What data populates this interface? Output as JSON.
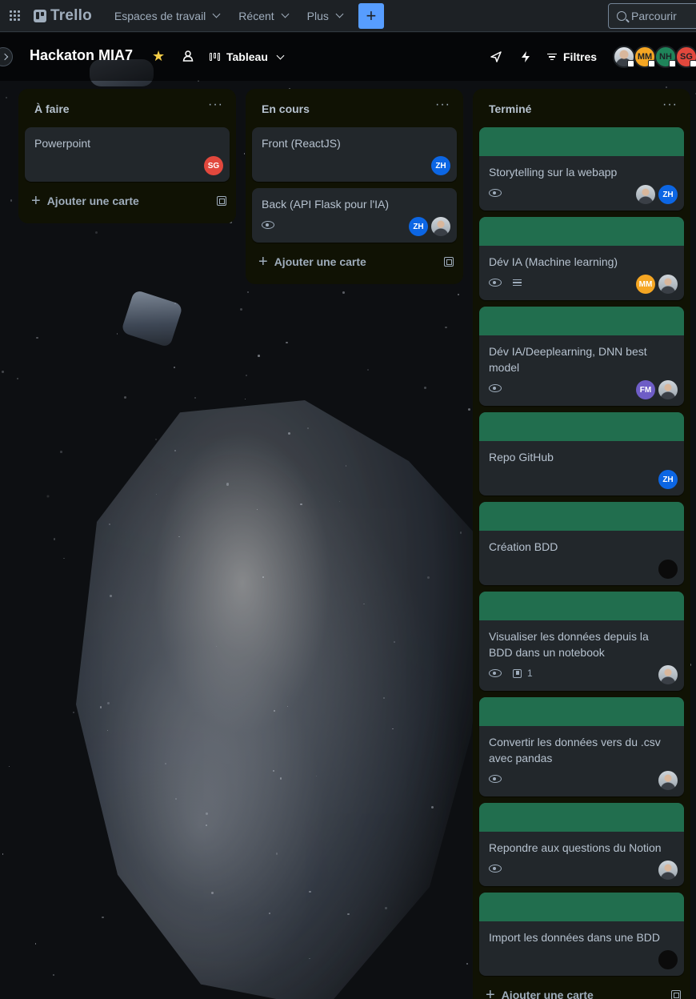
{
  "nav": {
    "logo": "Trello",
    "workspaces": "Espaces de travail",
    "recent": "Récent",
    "more": "Plus",
    "create": "+",
    "search_placeholder": "Parcourir"
  },
  "board": {
    "title": "Hackaton MIA7",
    "view": "Tableau",
    "filters": "Filtres",
    "members": [
      {
        "initials": "",
        "color": "#c9ced4",
        "photo": true
      },
      {
        "initials": "MM",
        "color": "#f5a623"
      },
      {
        "initials": "NH",
        "color": "#1f845a"
      },
      {
        "initials": "SG",
        "color": "#e2483d"
      }
    ]
  },
  "lists": [
    {
      "title": "À faire",
      "add_label": "Ajouter une carte",
      "cards": [
        {
          "title": "Powerpoint",
          "cover": false,
          "watch": false,
          "avatars": [
            {
              "initials": "SG",
              "color": "#e2483d"
            }
          ]
        }
      ]
    },
    {
      "title": "En cours",
      "add_label": "Ajouter une carte",
      "cards": [
        {
          "title": "Front (ReactJS)",
          "cover": false,
          "watch": false,
          "avatars": [
            {
              "initials": "ZH",
              "color": "#0c66e4"
            }
          ]
        },
        {
          "title": "Back (API Flask pour l'IA)",
          "cover": false,
          "watch": true,
          "avatars": [
            {
              "initials": "ZH",
              "color": "#0c66e4"
            },
            {
              "initials": "",
              "photo": true
            }
          ]
        }
      ]
    },
    {
      "title": "Terminé",
      "add_label": "Ajouter une carte",
      "cards": [
        {
          "title": "Storytelling sur la webapp",
          "cover": true,
          "watch": true,
          "avatars": [
            {
              "initials": "",
              "photo": true
            },
            {
              "initials": "ZH",
              "color": "#0c66e4"
            }
          ]
        },
        {
          "title": "Dév IA (Machine learning)",
          "cover": true,
          "watch": true,
          "description": true,
          "avatars": [
            {
              "initials": "MM",
              "color": "#f5a623"
            },
            {
              "initials": "",
              "photo": true
            }
          ]
        },
        {
          "title": "Dév IA/Deeplearning, DNN best model",
          "cover": true,
          "watch": true,
          "avatars": [
            {
              "initials": "FM",
              "color": "#6e5dc6"
            },
            {
              "initials": "",
              "photo": true
            }
          ]
        },
        {
          "title": "Repo GitHub",
          "cover": true,
          "watch": false,
          "avatars": [
            {
              "initials": "ZH",
              "color": "#0c66e4"
            }
          ]
        },
        {
          "title": "Création BDD",
          "cover": true,
          "watch": false,
          "avatars": [
            {
              "initials": "",
              "color": "#0b0b0b"
            }
          ]
        },
        {
          "title": "Visualiser les données depuis la BDD dans un notebook",
          "cover": true,
          "watch": true,
          "checklist": "1",
          "avatars": [
            {
              "initials": "",
              "photo": true
            }
          ]
        },
        {
          "title": "Convertir les données vers du .csv avec pandas",
          "cover": true,
          "watch": true,
          "avatars": [
            {
              "initials": "",
              "photo": true
            }
          ]
        },
        {
          "title": "Repondre aux questions du Notion",
          "cover": true,
          "watch": true,
          "avatars": [
            {
              "initials": "",
              "photo": true
            }
          ]
        },
        {
          "title": "Import les données dans une BDD",
          "cover": true,
          "watch": false,
          "avatars": [
            {
              "initials": "",
              "color": "#0b0b0b"
            }
          ]
        }
      ]
    }
  ]
}
